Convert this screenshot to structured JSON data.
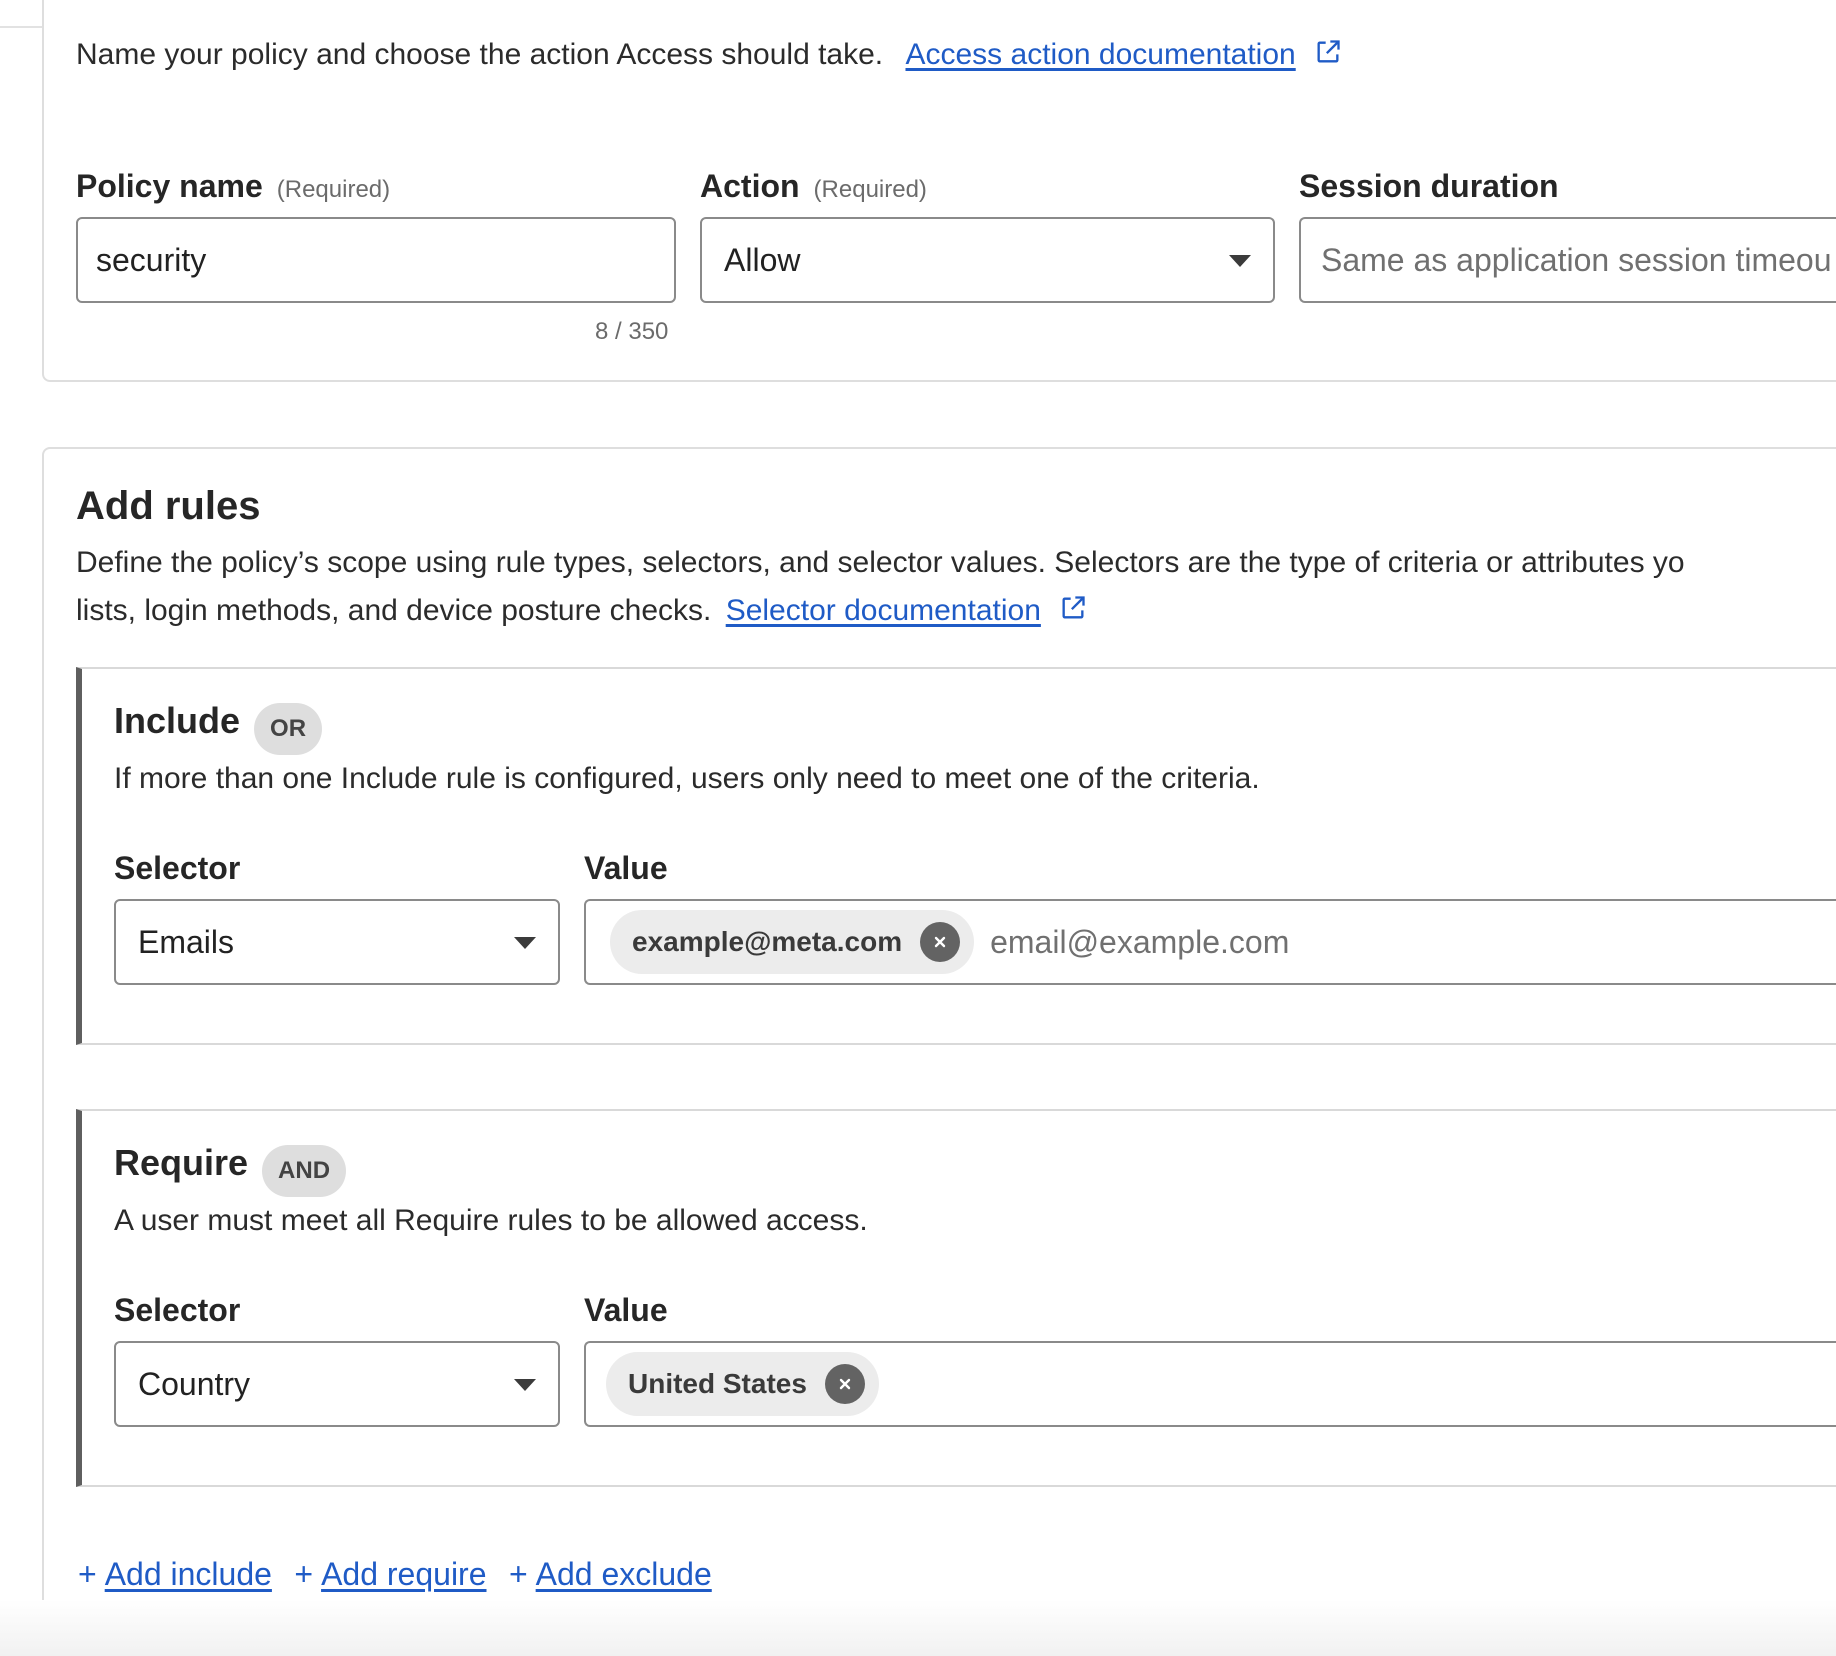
{
  "policy_section": {
    "description": "Name your policy and choose the action Access should take.",
    "doc_link": "Access action documentation",
    "policy_name": {
      "label": "Policy name",
      "required": "(Required)",
      "value": "security",
      "counter": "8 / 350"
    },
    "action": {
      "label": "Action",
      "required": "(Required)",
      "value": "Allow"
    },
    "session_duration": {
      "label": "Session duration",
      "placeholder": "Same as application session timeou"
    }
  },
  "rules_section": {
    "title": "Add rules",
    "description_line1": "Define the policy’s scope using rule types, selectors, and selector values. Selectors are the type of criteria or attributes yo",
    "description_line2": "lists, login methods, and device posture checks.",
    "doc_link": "Selector documentation",
    "include": {
      "title": "Include",
      "badge": "OR",
      "description": "If more than one Include rule is configured, users only need to meet one of the criteria.",
      "selector_label": "Selector",
      "selector_value": "Emails",
      "value_label": "Value",
      "chip": "example@meta.com",
      "value_placeholder": "email@example.com"
    },
    "require": {
      "title": "Require",
      "badge": "AND",
      "description": "A user must meet all Require rules to be allowed access.",
      "selector_label": "Selector",
      "selector_value": "Country",
      "value_label": "Value",
      "chip": "United States"
    },
    "add_links": {
      "plus": "+",
      "include": "Add include",
      "require": "Add require",
      "exclude": "Add exclude"
    }
  },
  "colors": {
    "link": "#1f5bc6",
    "group_accent": "#5f5f5f",
    "badge_bg": "#dedede",
    "chip_bg": "#ececec"
  },
  "icons": [
    "external-link-icon",
    "dropdown-caret-icon",
    "chip-remove-icon"
  ]
}
